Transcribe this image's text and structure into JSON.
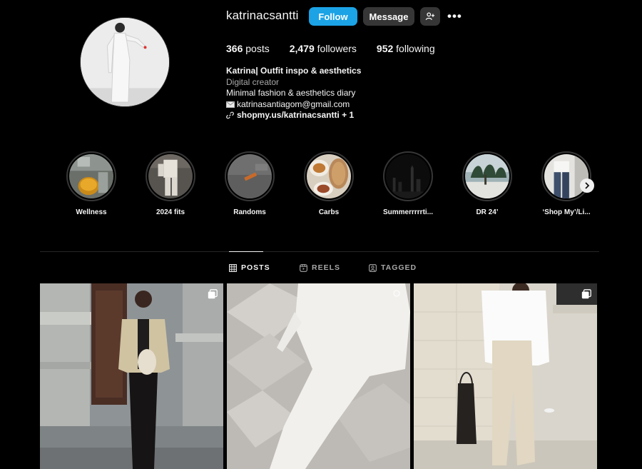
{
  "profile": {
    "username": "katrinacsantti",
    "follow_label": "Follow",
    "message_label": "Message",
    "more_label": "•••",
    "stats": {
      "posts_count": "366",
      "posts_label": "posts",
      "followers_count": "2,479",
      "followers_label": "followers",
      "following_count": "952",
      "following_label": "following"
    },
    "bio": {
      "name": "Katrina| Outfit inspo & aesthetics",
      "category": "Digital creator",
      "line1": "Minimal fashion & aesthetics diary",
      "email": "katrinasantiagom@gmail.com",
      "link": "shopmy.us/katrinacsantti + 1"
    }
  },
  "highlights": [
    {
      "label": "Wellness"
    },
    {
      "label": "2024 fits"
    },
    {
      "label": "Randoms"
    },
    {
      "label": "Carbs"
    },
    {
      "label": "Summerrrrrti..."
    },
    {
      "label": "DR 24’"
    },
    {
      "label": "‘Shop My’/Li..."
    }
  ],
  "tabs": [
    {
      "label": "POSTS",
      "icon": "grid-icon",
      "active": true
    },
    {
      "label": "REELS",
      "icon": "reels-icon",
      "active": false
    },
    {
      "label": "TAGGED",
      "icon": "tagged-icon",
      "active": false
    }
  ],
  "colors": {
    "background": "#000000",
    "follow_button": "#1ba3e6",
    "secondary_button": "#363636",
    "text_primary": "#f5f5f5",
    "text_secondary": "#a8a8a8"
  }
}
